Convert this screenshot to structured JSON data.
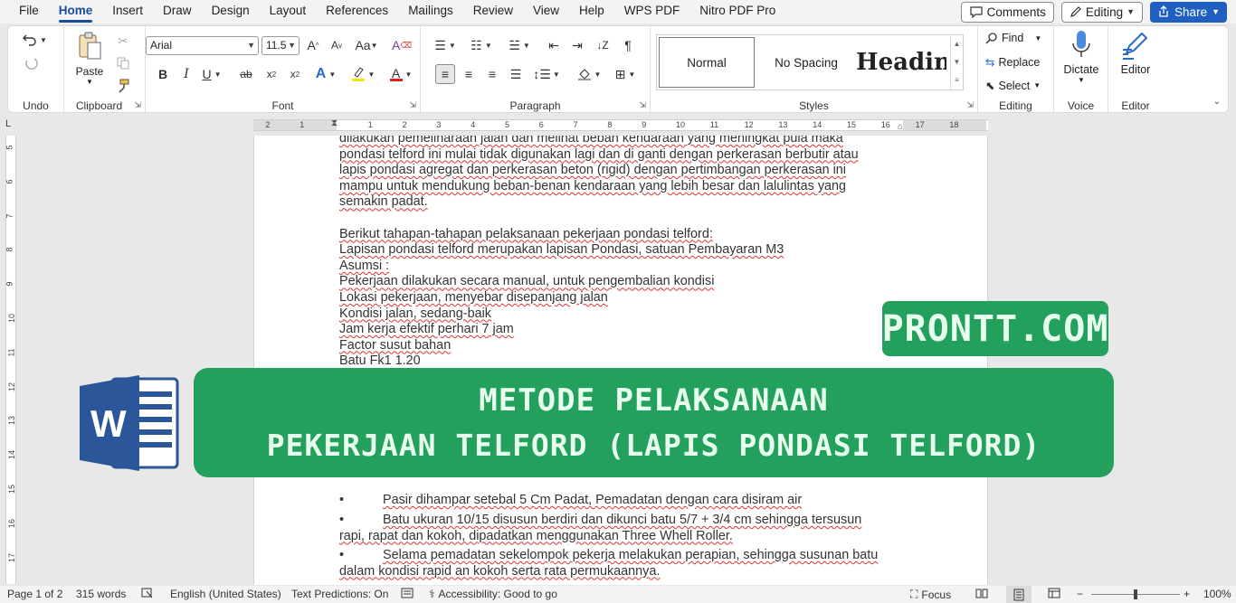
{
  "menu": {
    "tabs": [
      "File",
      "Home",
      "Insert",
      "Draw",
      "Design",
      "Layout",
      "References",
      "Mailings",
      "Review",
      "View",
      "Help",
      "WPS PDF",
      "Nitro PDF Pro"
    ],
    "comments_label": "Comments",
    "editing_label": "Editing",
    "share_label": "Share"
  },
  "ribbon": {
    "undo_group": "Undo",
    "clipboard_group": "Clipboard",
    "paste_label": "Paste",
    "font_group": "Font",
    "font_name": "Arial",
    "font_size": "11.5",
    "paragraph_group": "Paragraph",
    "styles_group": "Styles",
    "style_normal": "Normal",
    "style_nospacing": "No Spacing",
    "style_heading": "Headin",
    "editing_group": "Editing",
    "find_label": "Find",
    "replace_label": "Replace",
    "select_label": "Select",
    "voice_group": "Voice",
    "dictate_label": "Dictate",
    "editor_group": "Editor",
    "editor_label": "Editor"
  },
  "ruler": {
    "h_numbers": [
      "2",
      "1",
      "1",
      "2",
      "3",
      "4",
      "5",
      "6",
      "7",
      "8",
      "9",
      "10",
      "11",
      "12",
      "13",
      "14",
      "15",
      "16",
      "17",
      "18"
    ],
    "v_numbers": [
      "5",
      "6",
      "7",
      "8",
      "9",
      "10",
      "11",
      "12",
      "13",
      "14",
      "15",
      "16",
      "17"
    ]
  },
  "doc": {
    "p1_line1": "dilakukan pemeliharaan jalan dan melihat beban kendaraan yang meningkat pula maka",
    "p1_line2": "pondasi telford ini mulai tidak digunakan lagi dan di ganti dengan perkerasan berbutir atau",
    "p1_line3": "lapis pondasi agregat dan perkerasan beton (rigid) dengan pertimbangan perkerasan ini",
    "p1_line4": "mampu untuk mendukung beban-benan kendaraan yang lebih besar dan lalulintas yang",
    "p1_line5": "semakin padat.",
    "l1": "Berikut tahapan-tahapan pelaksanaan pekerjaan pondasi telford:",
    "l2": "Lapisan pondasi telford merupakan lapisan Pondasi, satuan Pembayaran M3",
    "l3": "Asumsi :",
    "l4": "Pekerjaan dilakukan secara manual, untuk pengembalian kondisi",
    "l5": "Lokasi pekerjaan, menyebar disepanjang jalan",
    "l6": "Kondisi jalan, sedang-baik",
    "l7": "Jam kerja efektif perhari 7 jam",
    "l8": "Factor susut bahan",
    "l9": "Batu Fk1 1.20",
    "bullet_char": "•",
    "b1": "Pasir dihampar setebal 5 Cm Padat, Pemadatan dengan cara disiram air",
    "b2_line1": "Batu ukuran 10/15 disusun berdiri dan dikunci batu 5/7 + 3/4 cm sehingga tersusun",
    "b2_line2": "rapi, rapat dan kokoh, dipadatkan menggunakan Three Whell Roller.",
    "b3_line1": "Selama pemadatan sekelompok pekerja melakukan perapian, sehingga susunan batu",
    "b3_line2": "dalam kondisi rapid an kokoh serta rata permukaannya."
  },
  "overlay": {
    "site": "PRONTT.COM",
    "title_line1": "METODE PELAKSANAAN",
    "title_line2": "PEKERJAAN TELFORD (LAPIS PONDASI TELFORD)",
    "word_letter": "W"
  },
  "status": {
    "page": "Page 1 of 2",
    "words": "315 words",
    "language": "English (United States)",
    "predictions": "Text Predictions: On",
    "accessibility": "Accessibility: Good to go",
    "focus": "Focus",
    "zoom": "100%"
  },
  "colors": {
    "accent": "#1a4b9c",
    "banner": "#22a05c",
    "share": "#1f5fbf"
  }
}
